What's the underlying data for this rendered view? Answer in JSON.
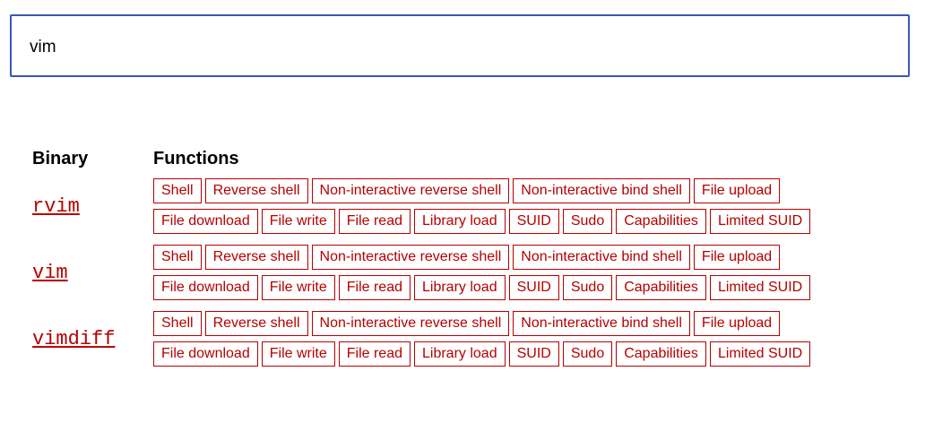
{
  "search": {
    "value": "vim",
    "placeholder": ""
  },
  "table": {
    "headers": {
      "binary": "Binary",
      "functions": "Functions"
    },
    "rows": [
      {
        "binary": "rvim",
        "functions": [
          "Shell",
          "Reverse shell",
          "Non-interactive reverse shell",
          "Non-interactive bind shell",
          "File upload",
          "File download",
          "File write",
          "File read",
          "Library load",
          "SUID",
          "Sudo",
          "Capabilities",
          "Limited SUID"
        ]
      },
      {
        "binary": "vim",
        "functions": [
          "Shell",
          "Reverse shell",
          "Non-interactive reverse shell",
          "Non-interactive bind shell",
          "File upload",
          "File download",
          "File write",
          "File read",
          "Library load",
          "SUID",
          "Sudo",
          "Capabilities",
          "Limited SUID"
        ]
      },
      {
        "binary": "vimdiff",
        "functions": [
          "Shell",
          "Reverse shell",
          "Non-interactive reverse shell",
          "Non-interactive bind shell",
          "File upload",
          "File download",
          "File write",
          "File read",
          "Library load",
          "SUID",
          "Sudo",
          "Capabilities",
          "Limited SUID"
        ]
      }
    ]
  },
  "colors": {
    "accent": "#b60000",
    "search_border": "#3c56b5"
  }
}
